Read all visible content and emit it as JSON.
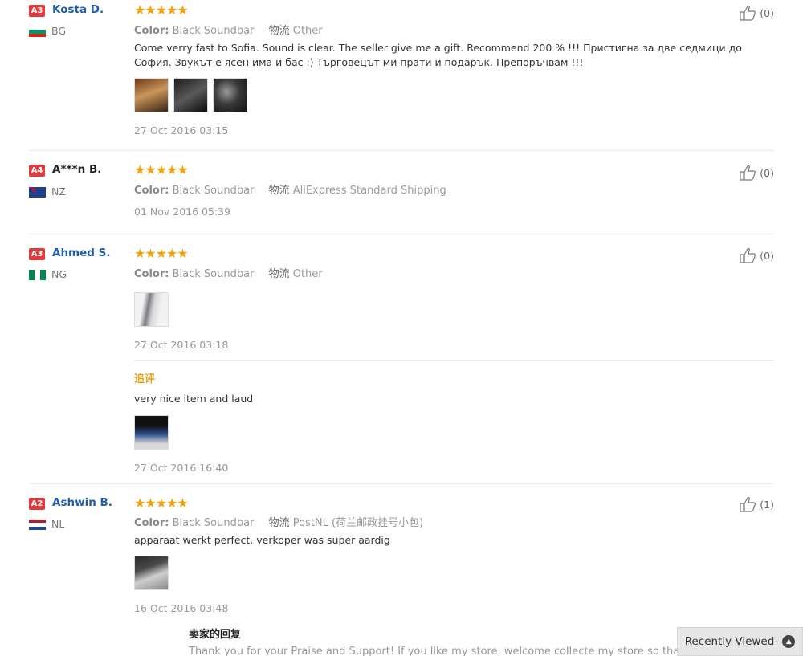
{
  "labels": {
    "color": "Color:",
    "shipping": "物流",
    "additional_feedback": "追评",
    "seller_reply": "卖家的回复"
  },
  "reviews": [
    {
      "badge": "A3",
      "name": "Kosta D.",
      "country": "BG",
      "stars": "★★★★★",
      "color_value": "Black Soundbar",
      "shipping_value": "Other",
      "text": "Come verry fast to Sofia. Sound is clear. The seller give me a gift. Recommend 200 % !!! Пристигна за две седмици до София. Звукът е ясен има и бас :) Търговецът ми прати и подарък. Препоръчвам !!!",
      "date": "27 Oct 2016 03:15",
      "helpful": "(0)"
    },
    {
      "badge": "A4",
      "name": "A***n B.",
      "country": "NZ",
      "stars": "★★★★★",
      "color_value": "Black Soundbar",
      "shipping_value": "AliExpress Standard Shipping",
      "date": "01 Nov 2016 05:39",
      "helpful": "(0)"
    },
    {
      "badge": "A3",
      "name": "Ahmed S.",
      "country": "NG",
      "stars": "★★★★★",
      "color_value": "Black Soundbar",
      "shipping_value": "Other",
      "date": "27 Oct 2016 03:18",
      "helpful": "(0)",
      "additional_text": "very nice item and laud",
      "additional_date": "27 Oct 2016 16:40"
    },
    {
      "badge": "A2",
      "name": "Ashwin B.",
      "country": "NL",
      "stars": "★★★★★",
      "color_value": "Black Soundbar",
      "shipping_value": "PostNL (荷兰邮政挂号小包)",
      "text": "apparaat werkt perfect. verkoper was super aardig",
      "date": "16 Oct 2016 03:48",
      "helpful": "(1)",
      "seller_reply_text": "Thank you for your Praise and Support! If you like my store, welcome collecte my store so that you can"
    }
  ],
  "recently_viewed": "Recently Viewed",
  "colors": {
    "badge_red": "#e4393c",
    "star_orange": "#f5a10b",
    "name_blue": "#1f5ea8",
    "additional_orange": "#e4a11b"
  }
}
